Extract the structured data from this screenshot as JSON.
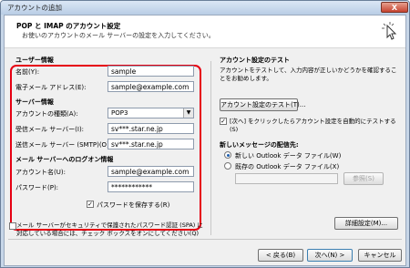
{
  "window": {
    "title": "アカウントの追加",
    "close_label": "X"
  },
  "header": {
    "title": "POP と IMAP のアカウント設定",
    "subtitle": "お使いのアカウントのメール サーバーの設定を入力してください。"
  },
  "user_info": {
    "heading": "ユーザー情報",
    "name_label": "名前(Y):",
    "name_value": "sample",
    "email_label": "電子メール アドレス(E):",
    "email_value": "sample@example.com"
  },
  "server_info": {
    "heading": "サーバー情報",
    "type_label": "アカウントの種類(A):",
    "type_value": "POP3",
    "incoming_label": "受信メール サーバー(I):",
    "incoming_value": "sv***.star.ne.jp",
    "outgoing_label": "送信メール サーバー (SMTP)(O):",
    "outgoing_value": "sv***.star.ne.jp"
  },
  "logon_info": {
    "heading": "メール サーバーへのログオン情報",
    "account_label": "アカウント名(U):",
    "account_value": "sample@example.com",
    "password_label": "パスワード(P):",
    "password_value": "************",
    "save_password_label": "パスワードを保存する(R)",
    "save_password_checked": true
  },
  "spa": {
    "label": "メール サーバーがセキュリティで保護されたパスワード認証 (SPA) に対応している場合には、チェック ボックスをオンにしてください(Q)",
    "checked": false
  },
  "test": {
    "heading": "アカウント設定のテスト",
    "description": "アカウントをテストして、入力内容が正しいかどうかを確認することをお勧めします。",
    "button_label": "アカウント設定のテスト(T)...",
    "auto_test_label": "[次へ] をクリックしたらアカウント設定を自動的にテストする(S)",
    "auto_test_checked": true
  },
  "delivery": {
    "heading": "新しいメッセージの配信先:",
    "new_file_label": "新しい Outlook データ ファイル(W)",
    "existing_file_label": "既存の Outlook データ ファイル(X)",
    "selected": "new",
    "path_value": "",
    "browse_label": "参照(S)"
  },
  "more_settings_label": "詳細設定(M)...",
  "footer": {
    "back_label": "< 戻る(B)",
    "next_label": "次へ(N) >",
    "cancel_label": "キャンセル"
  }
}
